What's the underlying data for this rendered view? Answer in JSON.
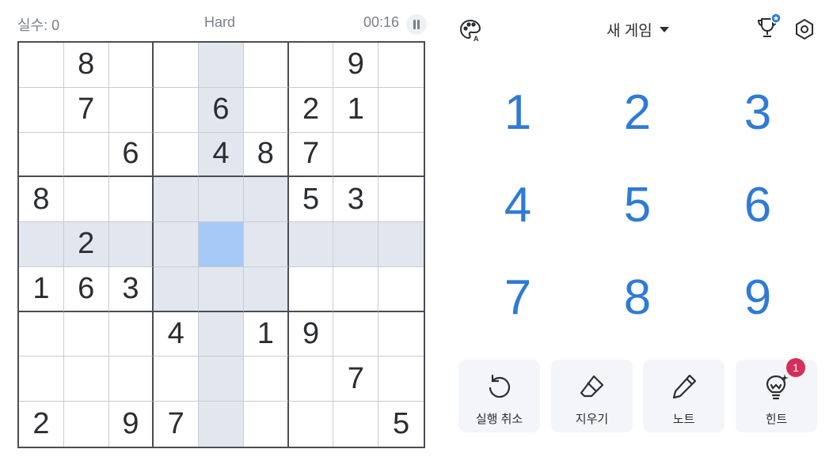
{
  "status": {
    "mistakes": "실수: 0",
    "difficulty": "Hard",
    "timer": "00:16"
  },
  "toolbar": {
    "new_game_label": "새 게임",
    "icons": [
      "palette-icon",
      "trophy-icon",
      "settings-icon"
    ]
  },
  "board": {
    "selected": [
      4,
      4
    ],
    "rows": [
      [
        "",
        "8",
        "",
        "",
        "",
        "",
        "",
        "9",
        ""
      ],
      [
        "",
        "7",
        "",
        "",
        "6",
        "",
        "2",
        "1",
        ""
      ],
      [
        "",
        "",
        "6",
        "",
        "4",
        "8",
        "7",
        "",
        ""
      ],
      [
        "8",
        "",
        "",
        "",
        "",
        "",
        "5",
        "3",
        ""
      ],
      [
        "",
        "2",
        "",
        "",
        "",
        "",
        "",
        "",
        ""
      ],
      [
        "1",
        "6",
        "3",
        "",
        "",
        "",
        "",
        "",
        ""
      ],
      [
        "",
        "",
        "",
        "4",
        "",
        "1",
        "9",
        "",
        ""
      ],
      [
        "",
        "",
        "",
        "",
        "",
        "",
        "",
        "7",
        ""
      ],
      [
        "2",
        "",
        "9",
        "7",
        "",
        "",
        "",
        "",
        "5"
      ]
    ]
  },
  "numpad": [
    "1",
    "2",
    "3",
    "4",
    "5",
    "6",
    "7",
    "8",
    "9"
  ],
  "actions": {
    "undo_label": "실행 취소",
    "erase_label": "지우기",
    "notes_label": "노트",
    "hint_label": "힌트",
    "hint_badge": "1"
  },
  "colors": {
    "accent": "#2f7ad6",
    "highlight": "#e2e6ef",
    "selected": "#a6c9f7",
    "badge": "#d32f5a"
  }
}
